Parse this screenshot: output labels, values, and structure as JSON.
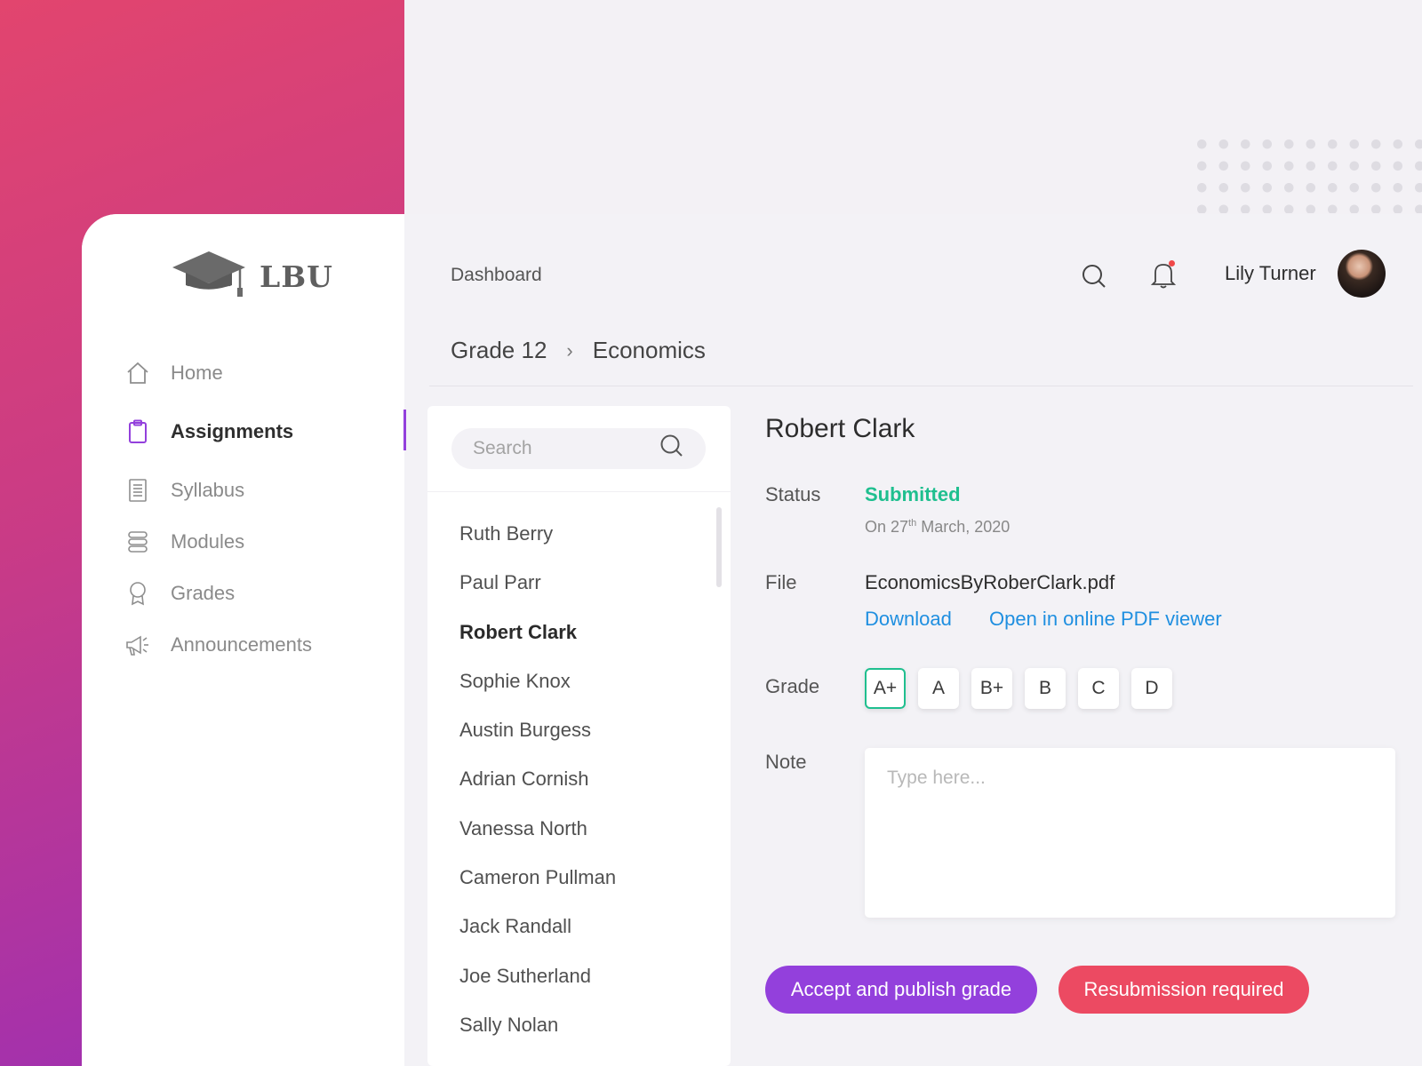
{
  "brand": {
    "name": "LBU",
    "icon": "graduation-cap-icon"
  },
  "sidebar": {
    "items": [
      {
        "label": "Home",
        "icon": "home-icon",
        "active": false
      },
      {
        "label": "Assignments",
        "icon": "clipboard-icon",
        "active": true
      },
      {
        "label": "Syllabus",
        "icon": "document-icon",
        "active": false
      },
      {
        "label": "Modules",
        "icon": "stack-icon",
        "active": false
      },
      {
        "label": "Grades",
        "icon": "award-icon",
        "active": false
      },
      {
        "label": "Announcements",
        "icon": "megaphone-icon",
        "active": false
      }
    ]
  },
  "header": {
    "title": "Dashboard",
    "user_name": "Lily Turner",
    "has_notification": true
  },
  "breadcrumb": {
    "grade": "Grade 12",
    "subject": "Economics"
  },
  "list": {
    "search_placeholder": "Search",
    "students": [
      "Ruth Berry",
      "Paul Parr",
      "Robert Clark",
      "Sophie Knox",
      "Austin Burgess",
      "Adrian Cornish",
      "Vanessa North",
      "Cameron Pullman",
      "Jack Randall",
      "Joe Sutherland",
      "Sally Nolan"
    ],
    "selected": "Robert Clark"
  },
  "detail": {
    "name": "Robert Clark",
    "status_label": "Status",
    "status_value": "Submitted",
    "date_prefix": "On 27",
    "date_suffix": "th",
    "date_rest": " March, 2020",
    "file_label": "File",
    "file_name": "EconomicsByRoberClark.pdf",
    "download": "Download",
    "open_viewer": "Open in online PDF viewer",
    "grade_label": "Grade",
    "grades": [
      "A+",
      "A",
      "B+",
      "B",
      "C",
      "D"
    ],
    "selected_grade": "A+",
    "note_label": "Note",
    "note_placeholder": "Type here...",
    "accept_button": "Accept and publish grade",
    "resubmit_button": "Resubmission required"
  },
  "colors": {
    "accent": "#9340dc",
    "success": "#1fbf8f",
    "link": "#1f8fe0",
    "danger": "#ec4a62"
  }
}
